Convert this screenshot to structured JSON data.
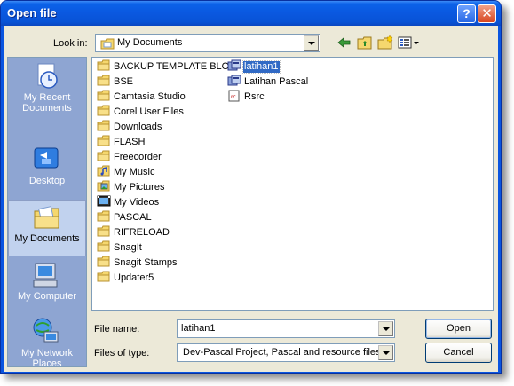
{
  "window": {
    "title": "Open file",
    "help_symbol": "?",
    "close_symbol": "✕"
  },
  "lookin": {
    "label": "Look in:",
    "value": "My Documents"
  },
  "places": [
    {
      "label": "My Recent Documents",
      "icon": "recent-documents-icon",
      "selected": false
    },
    {
      "label": "Desktop",
      "icon": "desktop-icon",
      "selected": false
    },
    {
      "label": "My Documents",
      "icon": "my-documents-icon",
      "selected": true
    },
    {
      "label": "My Computer",
      "icon": "my-computer-icon",
      "selected": false
    },
    {
      "label": "My Network Places",
      "icon": "network-places-icon",
      "selected": false
    }
  ],
  "files": {
    "column1": [
      "BACKUP TEMPLATE BLOG",
      "BSE",
      "Camtasia Studio",
      "Corel User Files",
      "Downloads",
      "FLASH",
      "Freecorder",
      "My Music",
      "My Pictures",
      "My Videos",
      "PASCAL",
      "RIFRELOAD",
      "SnagIt",
      "Snagit Stamps",
      "Updater5"
    ],
    "column2": [
      "latihan1",
      "Latihan Pascal",
      "Rsrc"
    ]
  },
  "filename": {
    "label": "File name:",
    "value": "latihan1"
  },
  "filetype": {
    "label": "Files of type:",
    "value": "Dev-Pascal Project, Pascal and resource files"
  },
  "buttons": {
    "open": "Open",
    "cancel": "Cancel"
  }
}
